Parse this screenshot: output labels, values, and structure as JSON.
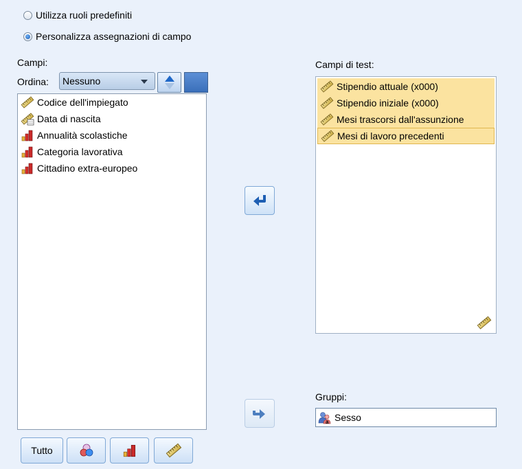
{
  "roles": {
    "predefined_label": "Utilizza ruoli predefiniti",
    "custom_label": "Personalizza assegnazioni di campo",
    "selected": "custom"
  },
  "fields": {
    "label": "Campi:",
    "sort_label": "Ordina:",
    "sort_value": "Nessuno",
    "items": [
      {
        "label": "Codice dell'impiegato",
        "icon": "ruler-icon"
      },
      {
        "label": "Data di nascita",
        "icon": "date-ruler-icon"
      },
      {
        "label": "Annualità scolastiche",
        "icon": "bar-chart-icon"
      },
      {
        "label": "Categoria lavorativa",
        "icon": "bar-chart-icon"
      },
      {
        "label": "Cittadino extra-europeo",
        "icon": "bar-chart-icon"
      }
    ],
    "filter_all_label": "Tutto"
  },
  "test_fields": {
    "label": "Campi di test:",
    "items": [
      {
        "label": "Stipendio attuale (x000)",
        "icon": "ruler-icon"
      },
      {
        "label": "Stipendio iniziale (x000)",
        "icon": "ruler-icon"
      },
      {
        "label": "Mesi trascorsi dall'assunzione",
        "icon": "ruler-icon"
      },
      {
        "label": "Mesi di lavoro precedenti",
        "icon": "ruler-icon"
      }
    ]
  },
  "groups": {
    "label": "Gruppi:",
    "value": "Sesso",
    "icon": "nominal-people-icon"
  },
  "colors": {
    "panel_bg": "#eaf1fb",
    "selection": "#fbe3a0",
    "accent": "#1d5fb3"
  }
}
